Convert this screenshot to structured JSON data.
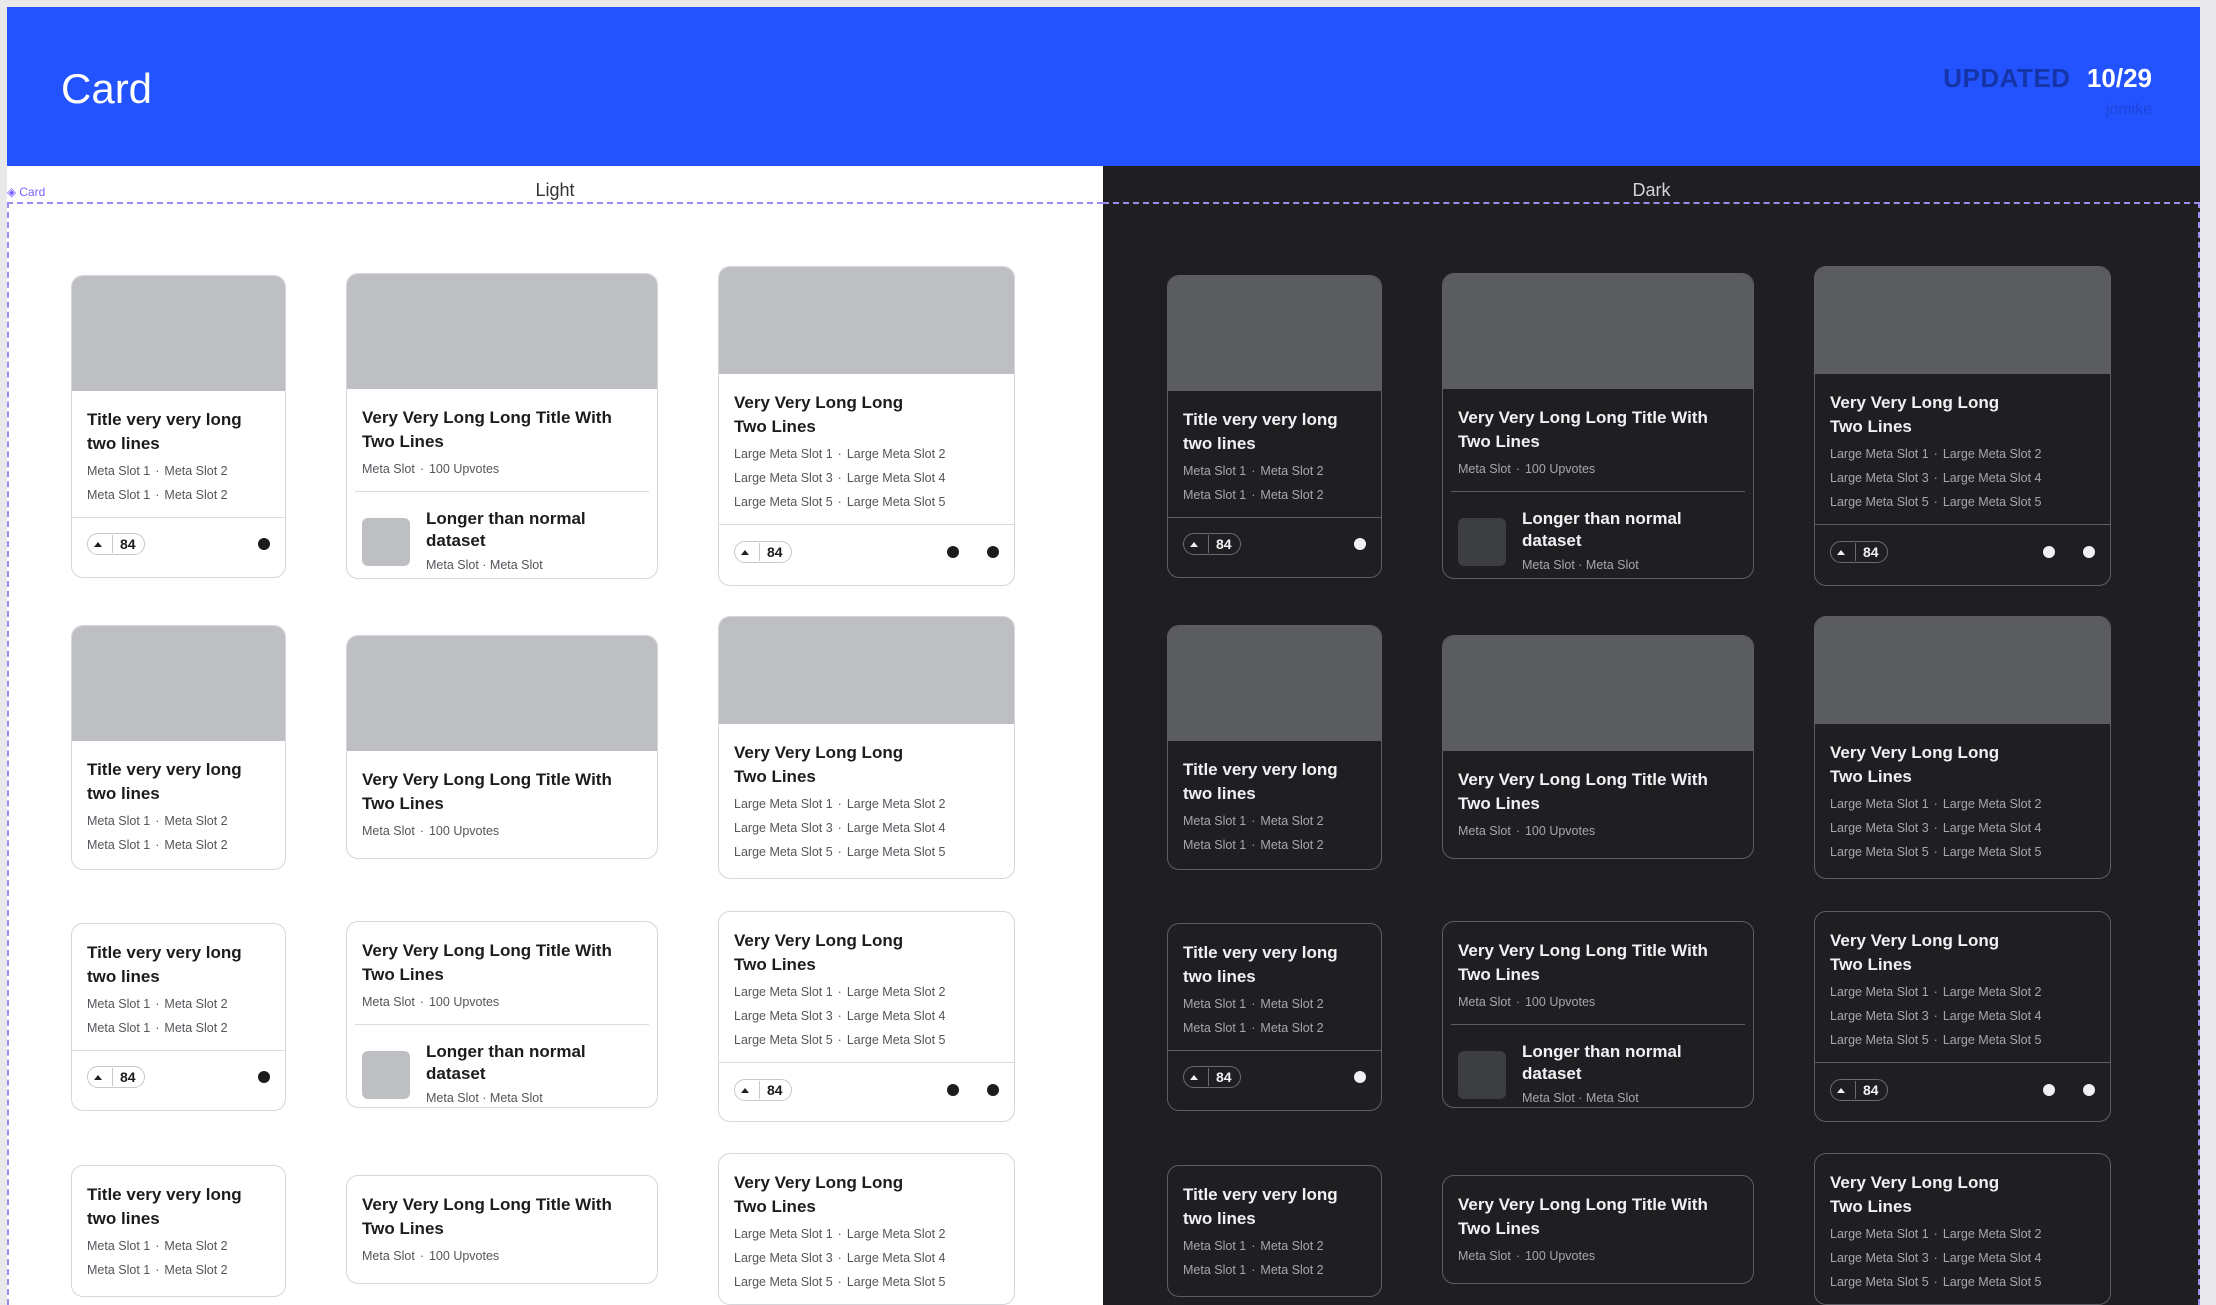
{
  "header": {
    "title": "Card",
    "updated_label": "UPDATED",
    "updated_date": "10/29",
    "updated_user": "jomike"
  },
  "frame": {
    "tag": "Card"
  },
  "panels": {
    "light": {
      "label": "Light"
    },
    "dark": {
      "label": "Dark"
    }
  },
  "cards": {
    "short_title": "Title very very long two lines",
    "mid_title": "Very Very Long Long Title With Two Lines",
    "long_title": "Very Very Long Long Two Lines",
    "meta_slot_1": "Meta Slot 1",
    "meta_slot_2": "Meta Slot 2",
    "meta_slot": "Meta Slot",
    "upvotes": "100 Upvotes",
    "large_meta_1": "Large Meta Slot 1",
    "large_meta_2": "Large Meta Slot 2",
    "large_meta_3": "Large Meta Slot 3",
    "large_meta_4": "Large Meta Slot 4",
    "large_meta_5": "Large Meta Slot 5",
    "vote_count": "84",
    "dataset_title": "Longer than normal dataset",
    "dataset_meta": "Meta Slot · Meta Slot",
    "separator": "·"
  },
  "colors": {
    "header_bg": "#2353ff",
    "light_bg": "#ffffff",
    "dark_bg": "#1f1f22",
    "frame_guide": "#9b8cf2",
    "light_media": "#bdbfc3",
    "dark_media": "#5b5c60"
  },
  "icons": [
    "upvote-arrow-icon",
    "status-dot-icon",
    "frame-icon"
  ]
}
